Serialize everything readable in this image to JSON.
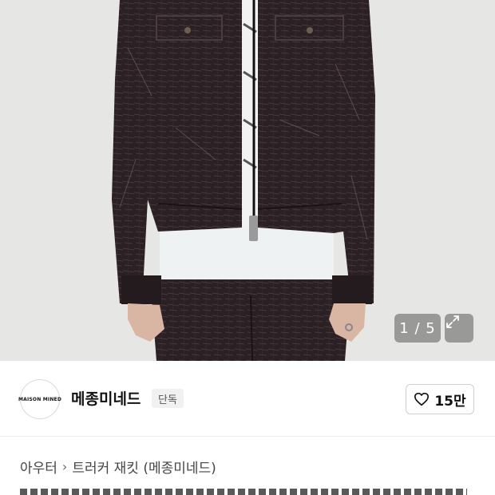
{
  "gallery": {
    "current": "1",
    "separator": "/",
    "total": "5",
    "counter_text": "1 / 5",
    "expand_icon": "expand-arrows-icon"
  },
  "brand": {
    "logo_text": "MAISON MINED",
    "name": "메종미네드",
    "exclusive_badge": "단독"
  },
  "like": {
    "icon": "heart-outline-icon",
    "count": "15만"
  },
  "breadcrumb": {
    "category": "아우터",
    "separator_icon": "chevron-right-icon",
    "item": "트러커 재킷 (메종미네드)"
  },
  "colors": {
    "image_bg": "#e6e6e4",
    "jacket": "#2b2124",
    "tee": "#eef2f3"
  }
}
